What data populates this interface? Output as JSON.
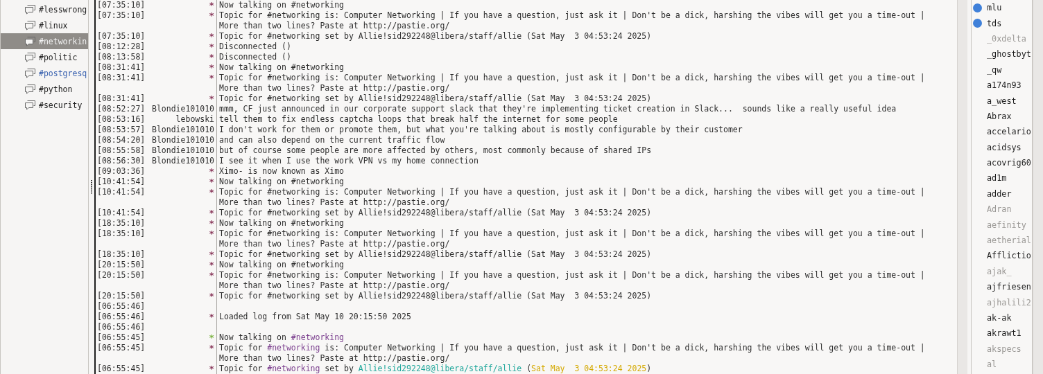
{
  "channels": [
    {
      "name": "#lesswrong",
      "selected": false,
      "activity": false
    },
    {
      "name": "#linux",
      "selected": false,
      "activity": false
    },
    {
      "name": "#networkin",
      "selected": true,
      "activity": false
    },
    {
      "name": "#politic",
      "selected": false,
      "activity": false
    },
    {
      "name": "#postgresq",
      "selected": false,
      "activity": true
    },
    {
      "name": "#python",
      "selected": false,
      "activity": false
    },
    {
      "name": "#security",
      "selected": false,
      "activity": false
    }
  ],
  "messages": [
    {
      "time": "[07:35:10]",
      "nick": "*",
      "color": "#8a3a5c",
      "parts": [
        {
          "text": "Now talking on #networking"
        }
      ]
    },
    {
      "time": "[07:35:10]",
      "nick": "*",
      "color": "#8a3a5c",
      "parts": [
        {
          "text": "Topic for #networking is: Computer Networking | If you have a question, just ask it | Don't be a dick, harshing the vibes will get you a time-out | More than two lines? Paste at http://pastie.org/"
        }
      ]
    },
    {
      "time": "[07:35:10]",
      "nick": "*",
      "color": "#8a3a5c",
      "parts": [
        {
          "text": "Topic for #networking set by Allie!sid292248@libera/staff/allie (Sat May  3 04:53:24 2025)"
        }
      ]
    },
    {
      "time": "[08:12:28]",
      "nick": "*",
      "color": "#8a3a5c",
      "parts": [
        {
          "text": "Disconnected ()"
        }
      ]
    },
    {
      "time": "[08:13:58]",
      "nick": "*",
      "color": "#8a3a5c",
      "parts": [
        {
          "text": "Disconnected ()"
        }
      ]
    },
    {
      "time": "[08:31:41]",
      "nick": "*",
      "color": "#8a3a5c",
      "parts": [
        {
          "text": "Now talking on #networking"
        }
      ]
    },
    {
      "time": "[08:31:41]",
      "nick": "*",
      "color": "#8a3a5c",
      "parts": [
        {
          "text": "Topic for #networking is: Computer Networking | If you have a question, just ask it | Don't be a dick, harshing the vibes will get you a time-out | More than two lines? Paste at http://pastie.org/"
        }
      ]
    },
    {
      "time": "[08:31:41]",
      "nick": "*",
      "color": "#8a3a5c",
      "parts": [
        {
          "text": "Topic for #networking set by Allie!sid292248@libera/staff/allie (Sat May  3 04:53:24 2025)"
        }
      ]
    },
    {
      "time": "[08:52:27]",
      "nick": "Blondie101010",
      "parts": [
        {
          "text": "mmm, CF just announced in our corporate support slack that they're implementing ticket creation in Slack...  sounds like a really useful idea"
        }
      ]
    },
    {
      "time": "[08:53:16]",
      "nick": "lebowski",
      "parts": [
        {
          "text": "tell them to fix endless captcha loops that break half the internet for some people"
        }
      ]
    },
    {
      "time": "[08:53:57]",
      "nick": "Blondie101010",
      "parts": [
        {
          "text": "I don't work for them or promote them, but what you're talking about is mostly configurable by their customer"
        }
      ]
    },
    {
      "time": "[08:54:20]",
      "nick": "Blondie101010",
      "parts": [
        {
          "text": "and can also depend on the current traffic flow"
        }
      ]
    },
    {
      "time": "[08:55:58]",
      "nick": "Blondie101010",
      "parts": [
        {
          "text": "but of course some people are more affected by others, most commonly because of shared IPs"
        }
      ]
    },
    {
      "time": "[08:56:30]",
      "nick": "Blondie101010",
      "parts": [
        {
          "text": "I see it when I use the work VPN vs my home connection"
        }
      ]
    },
    {
      "time": "[09:03:36]",
      "nick": "*",
      "color": "#8a3a5c",
      "parts": [
        {
          "text": "Ximo- is now known as Ximo"
        }
      ]
    },
    {
      "time": "[10:41:54]",
      "nick": "*",
      "color": "#8a3a5c",
      "parts": [
        {
          "text": "Now talking on #networking"
        }
      ]
    },
    {
      "time": "[10:41:54]",
      "nick": "*",
      "color": "#8a3a5c",
      "parts": [
        {
          "text": "Topic for #networking is: Computer Networking | If you have a question, just ask it | Don't be a dick, harshing the vibes will get you a time-out | More than two lines? Paste at http://pastie.org/"
        }
      ]
    },
    {
      "time": "[10:41:54]",
      "nick": "*",
      "color": "#8a3a5c",
      "parts": [
        {
          "text": "Topic for #networking set by Allie!sid292248@libera/staff/allie (Sat May  3 04:53:24 2025)"
        }
      ]
    },
    {
      "time": "[18:35:10]",
      "nick": "*",
      "color": "#8a3a5c",
      "parts": [
        {
          "text": "Now talking on #networking"
        }
      ]
    },
    {
      "time": "[18:35:10]",
      "nick": "*",
      "color": "#8a3a5c",
      "parts": [
        {
          "text": "Topic for #networking is: Computer Networking | If you have a question, just ask it | Don't be a dick, harshing the vibes will get you a time-out | More than two lines? Paste at http://pastie.org/"
        }
      ]
    },
    {
      "time": "[18:35:10]",
      "nick": "*",
      "color": "#8a3a5c",
      "parts": [
        {
          "text": "Topic for #networking set by Allie!sid292248@libera/staff/allie (Sat May  3 04:53:24 2025)"
        }
      ]
    },
    {
      "time": "[20:15:50]",
      "nick": "*",
      "color": "#8a3a5c",
      "parts": [
        {
          "text": "Now talking on #networking"
        }
      ]
    },
    {
      "time": "[20:15:50]",
      "nick": "*",
      "color": "#8a3a5c",
      "parts": [
        {
          "text": "Topic for #networking is: Computer Networking | If you have a question, just ask it | Don't be a dick, harshing the vibes will get you a time-out | More than two lines? Paste at http://pastie.org/"
        }
      ]
    },
    {
      "time": "[20:15:50]",
      "nick": "*",
      "color": "#8a3a5c",
      "parts": [
        {
          "text": "Topic for #networking set by Allie!sid292248@libera/staff/allie (Sat May  3 04:53:24 2025)"
        }
      ]
    },
    {
      "time": "[06:55:46]"
    },
    {
      "time": "[06:55:46]",
      "nick": "*",
      "color": "#8a3a5c",
      "parts": [
        {
          "text": "Loaded log from Sat May 10 20:15:50 2025"
        }
      ]
    },
    {
      "time": "[06:55:46]"
    },
    {
      "time": "[06:55:45]",
      "nick": "*",
      "color": "#7cb342",
      "parts": [
        {
          "text": "Now talking on "
        },
        {
          "text": "#networking",
          "color": "#7b3f8e"
        }
      ]
    },
    {
      "time": "[06:55:45]",
      "nick": "*",
      "color": "#8a3a5c",
      "parts": [
        {
          "text": "Topic for "
        },
        {
          "text": "#networking",
          "color": "#7b3f8e"
        },
        {
          "text": " is: Computer Networking | If you have a question, just ask it | Don't be a dick, harshing the vibes will get you a time-out | More than two lines? Paste at http://pastie.org/"
        }
      ]
    },
    {
      "time": "[06:55:45]",
      "nick": "*",
      "color": "#8a3a5c",
      "parts": [
        {
          "text": "Topic for "
        },
        {
          "text": "#networking",
          "color": "#7b3f8e"
        },
        {
          "text": " set by "
        },
        {
          "text": "Allie!sid292248@libera/staff/allie",
          "color": "#1fa79b"
        },
        {
          "text": " ("
        },
        {
          "text": "Sat May  3 04:53:24 2025",
          "color": "#d4a900"
        },
        {
          "text": ")"
        }
      ]
    }
  ],
  "users": [
    {
      "name": "mlu",
      "op": true,
      "away": false
    },
    {
      "name": "tds",
      "op": true,
      "away": false
    },
    {
      "name": "_0xdelta",
      "op": false,
      "away": true
    },
    {
      "name": "_ghostbyt",
      "op": false,
      "away": false
    },
    {
      "name": "_qw",
      "op": false,
      "away": false
    },
    {
      "name": "a174n93",
      "op": false,
      "away": false
    },
    {
      "name": "a_west",
      "op": false,
      "away": false
    },
    {
      "name": "Abrax",
      "op": false,
      "away": false
    },
    {
      "name": "accelario",
      "op": false,
      "away": false
    },
    {
      "name": "acidsys",
      "op": false,
      "away": false
    },
    {
      "name": "acovrig60",
      "op": false,
      "away": false
    },
    {
      "name": "ad1m",
      "op": false,
      "away": false
    },
    {
      "name": "adder",
      "op": false,
      "away": false
    },
    {
      "name": "Adran",
      "op": false,
      "away": true
    },
    {
      "name": "aefinity",
      "op": false,
      "away": true
    },
    {
      "name": "aetherial",
      "op": false,
      "away": true
    },
    {
      "name": "Afflictio",
      "op": false,
      "away": false
    },
    {
      "name": "ajak_",
      "op": false,
      "away": true
    },
    {
      "name": "ajfriesen",
      "op": false,
      "away": false
    },
    {
      "name": "ajhalili2",
      "op": false,
      "away": true
    },
    {
      "name": "ak-ak",
      "op": false,
      "away": false
    },
    {
      "name": "akrawt1",
      "op": false,
      "away": false
    },
    {
      "name": "akspecs",
      "op": false,
      "away": true
    },
    {
      "name": "al",
      "op": false,
      "away": true
    }
  ]
}
